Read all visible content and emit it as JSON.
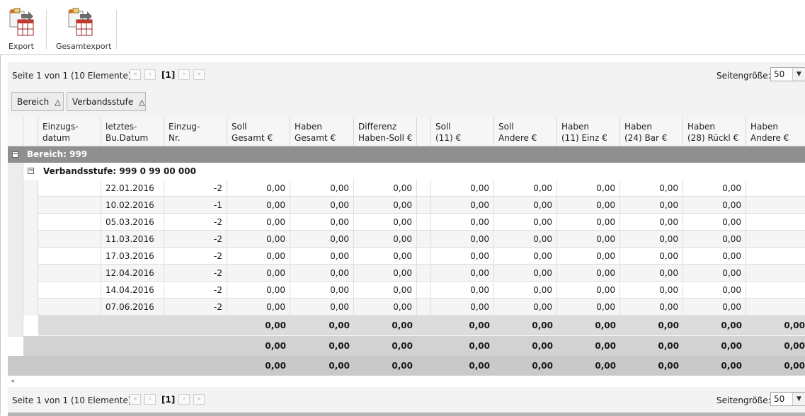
{
  "toolbar": {
    "export_label": "Export",
    "gesamtexport_label": "Gesamtexport"
  },
  "pager": {
    "info": "Seite 1 von 1 (10 Elemente)",
    "current": "[1]",
    "page_size_label": "Seitengröße:",
    "page_size_value": "50"
  },
  "group_panel": {
    "chips": [
      "Bereich",
      "Verbandsstufe"
    ]
  },
  "columns": [
    {
      "line1": "Einzugs-",
      "line2": "datum"
    },
    {
      "line1": "letztes-",
      "line2": "Bu.Datum"
    },
    {
      "line1": "Einzug-",
      "line2": "Nr."
    },
    {
      "line1": "Soll",
      "line2": "Gesamt €"
    },
    {
      "line1": "Haben",
      "line2": "Gesamt €"
    },
    {
      "line1": "Differenz",
      "line2": "Haben-Soll €"
    },
    {
      "line1": "",
      "line2": ""
    },
    {
      "line1": "Soll",
      "line2": "(11) €"
    },
    {
      "line1": "Soll",
      "line2": "Andere €"
    },
    {
      "line1": "Haben",
      "line2": "(11) Einz €"
    },
    {
      "line1": "Haben",
      "line2": "(24) Bar €"
    },
    {
      "line1": "Haben",
      "line2": "(28) Rückl €"
    },
    {
      "line1": "Haben",
      "line2": "Andere €"
    }
  ],
  "groups": {
    "bereich": "Bereich: 999",
    "verbandsstufe": "Verbandsstufe: 999 0 99 00 000"
  },
  "rows": [
    {
      "datum": "",
      "bu_datum": "22.01.2016",
      "nr": "-2",
      "soll_gesamt": "0,00",
      "haben_gesamt": "0,00",
      "differenz": "0,00",
      "soll_11": "0,00",
      "soll_andere": "0,00",
      "haben_11": "0,00",
      "haben_24": "0,00",
      "haben_28": "0,00"
    },
    {
      "datum": "",
      "bu_datum": "10.02.2016",
      "nr": "-1",
      "soll_gesamt": "0,00",
      "haben_gesamt": "0,00",
      "differenz": "0,00",
      "soll_11": "0,00",
      "soll_andere": "0,00",
      "haben_11": "0,00",
      "haben_24": "0,00",
      "haben_28": "0,00"
    },
    {
      "datum": "",
      "bu_datum": "05.03.2016",
      "nr": "-2",
      "soll_gesamt": "0,00",
      "haben_gesamt": "0,00",
      "differenz": "0,00",
      "soll_11": "0,00",
      "soll_andere": "0,00",
      "haben_11": "0,00",
      "haben_24": "0,00",
      "haben_28": "0,00"
    },
    {
      "datum": "",
      "bu_datum": "11.03.2016",
      "nr": "-2",
      "soll_gesamt": "0,00",
      "haben_gesamt": "0,00",
      "differenz": "0,00",
      "soll_11": "0,00",
      "soll_andere": "0,00",
      "haben_11": "0,00",
      "haben_24": "0,00",
      "haben_28": "0,00"
    },
    {
      "datum": "",
      "bu_datum": "17.03.2016",
      "nr": "-2",
      "soll_gesamt": "0,00",
      "haben_gesamt": "0,00",
      "differenz": "0,00",
      "soll_11": "0,00",
      "soll_andere": "0,00",
      "haben_11": "0,00",
      "haben_24": "0,00",
      "haben_28": "0,00"
    },
    {
      "datum": "",
      "bu_datum": "12.04.2016",
      "nr": "-2",
      "soll_gesamt": "0,00",
      "haben_gesamt": "0,00",
      "differenz": "0,00",
      "soll_11": "0,00",
      "soll_andere": "0,00",
      "haben_11": "0,00",
      "haben_24": "0,00",
      "haben_28": "0,00"
    },
    {
      "datum": "",
      "bu_datum": "14.04.2016",
      "nr": "-2",
      "soll_gesamt": "0,00",
      "haben_gesamt": "0,00",
      "differenz": "0,00",
      "soll_11": "0,00",
      "soll_andere": "0,00",
      "haben_11": "0,00",
      "haben_24": "0,00",
      "haben_28": "0,00"
    },
    {
      "datum": "",
      "bu_datum": "07.06.2016",
      "nr": "-2",
      "soll_gesamt": "0,00",
      "haben_gesamt": "0,00",
      "differenz": "0,00",
      "soll_11": "0,00",
      "soll_andere": "0,00",
      "haben_11": "0,00",
      "haben_24": "0,00",
      "haben_28": "0,00"
    }
  ],
  "summaries": [
    [
      "0,00",
      "0,00",
      "0,00",
      "0,00",
      "0,00",
      "0,00",
      "0,00",
      "0,00",
      "0,00"
    ],
    [
      "0,00",
      "0,00",
      "0,00",
      "0,00",
      "0,00",
      "0,00",
      "0,00",
      "0,00",
      "0,00"
    ],
    [
      "0,00",
      "0,00",
      "0,00",
      "0,00",
      "0,00",
      "0,00",
      "0,00",
      "0,00",
      "0,00"
    ]
  ]
}
